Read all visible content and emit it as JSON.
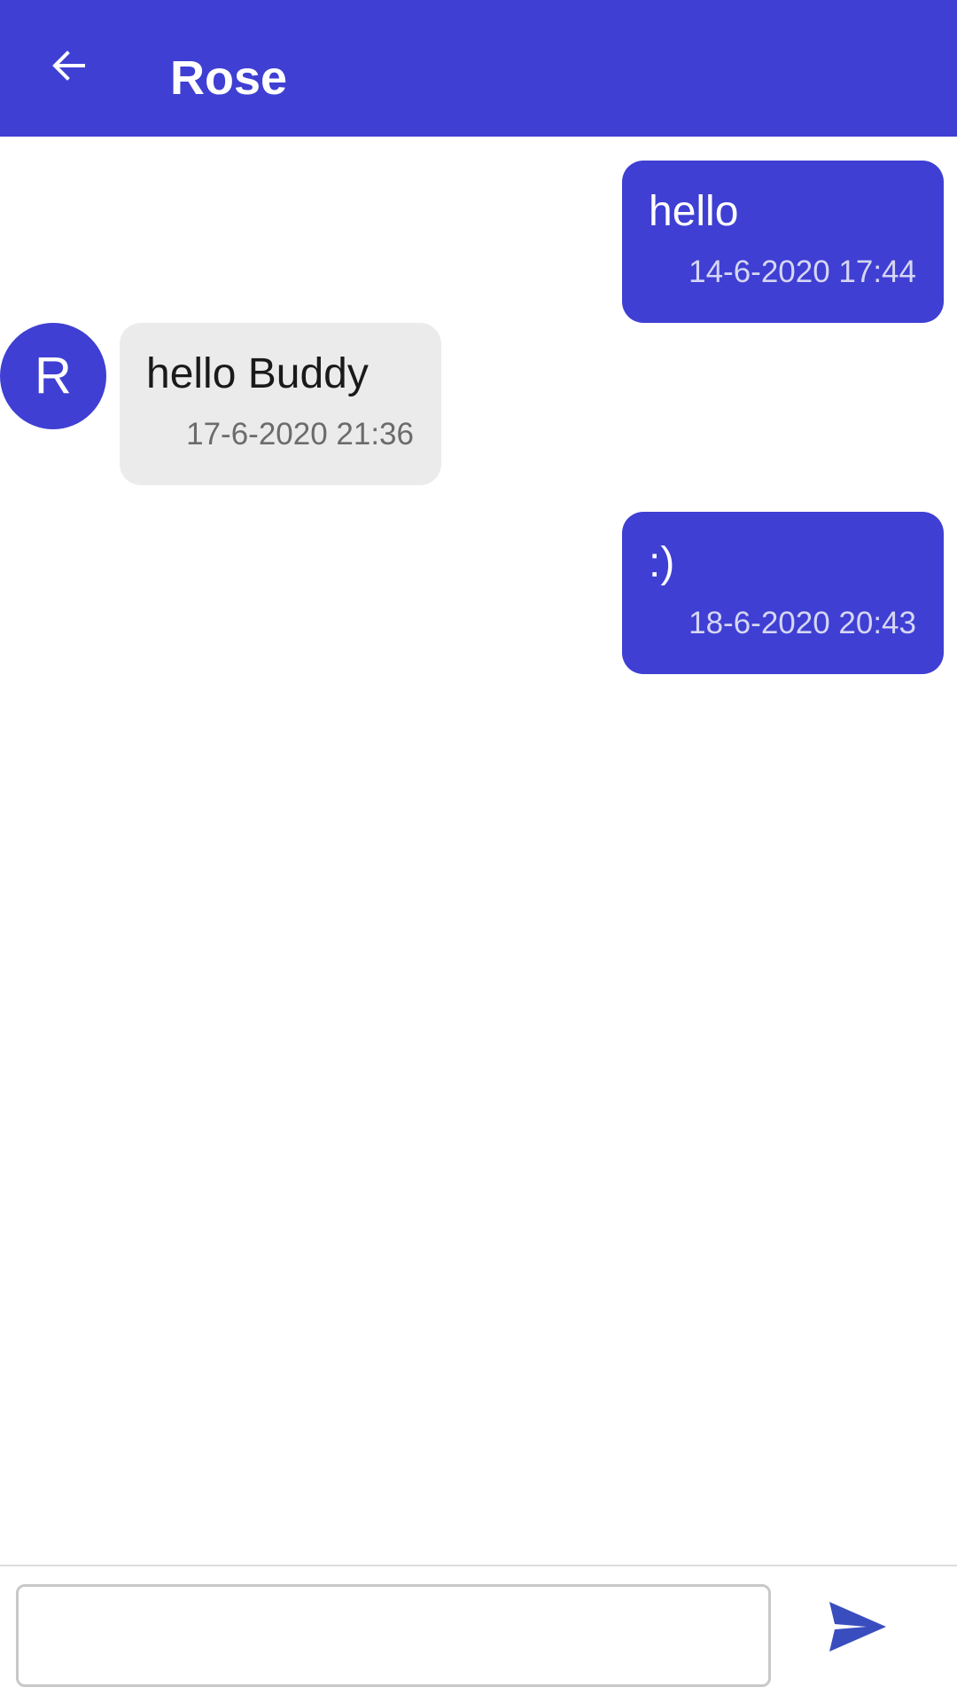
{
  "header": {
    "title": "Rose",
    "back_icon": "arrow-left-icon"
  },
  "messages": [
    {
      "direction": "outgoing",
      "text": "hello",
      "time": "14-6-2020 17:44"
    },
    {
      "direction": "incoming",
      "avatar_initial": "R",
      "text": "hello Buddy",
      "time": "17-6-2020 21:36"
    },
    {
      "direction": "outgoing",
      "text": ":)",
      "time": "18-6-2020 20:43"
    }
  ],
  "composer": {
    "input_value": "",
    "send_icon": "send-icon"
  },
  "colors": {
    "accent": "#3f3fd4",
    "incoming_bubble": "#ebebeb",
    "send_icon": "#3a4dbf"
  }
}
